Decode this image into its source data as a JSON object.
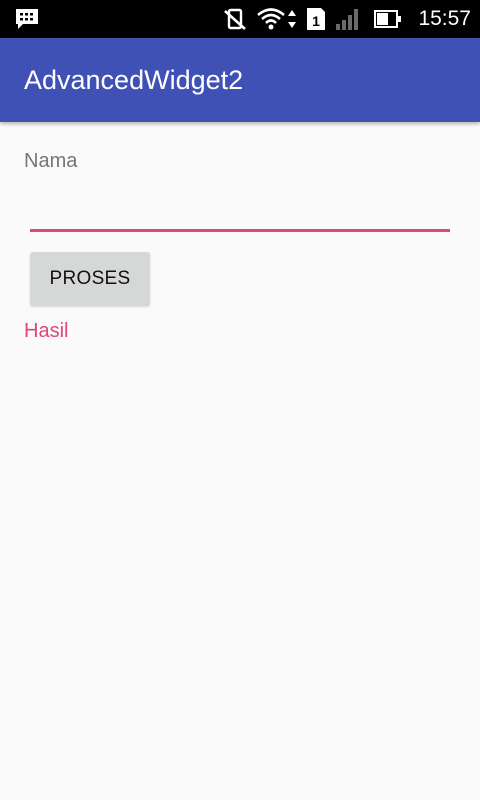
{
  "status_bar": {
    "time": "15:57",
    "sim_slot": "1",
    "icons": [
      "bbm-notification-icon",
      "vibrate-mute-icon",
      "wifi-icon",
      "data-arrows-icon",
      "sim-icon",
      "signal-icon",
      "battery-icon"
    ]
  },
  "app_bar": {
    "title": "AdvancedWidget2",
    "color": "#3f51b5"
  },
  "form": {
    "name_label": "Nama",
    "name_value": "",
    "name_placeholder": "",
    "button_label": "PROSES",
    "result_text": "Hasil",
    "accent_color": "#e0457b"
  }
}
